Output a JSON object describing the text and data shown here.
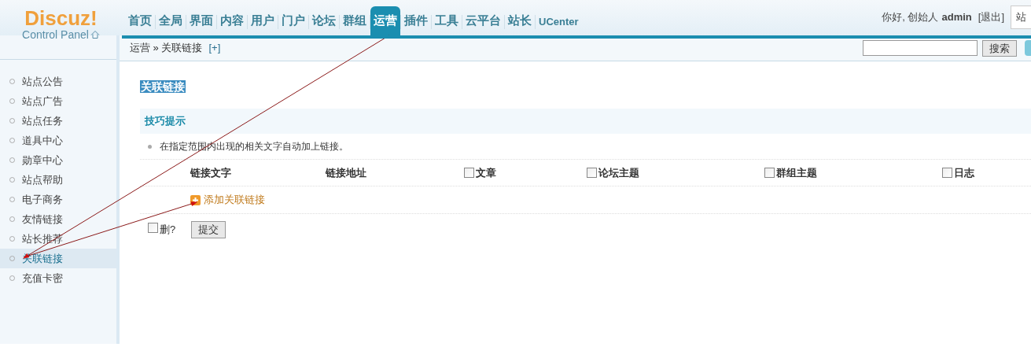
{
  "logo": {
    "title": "Discuz!",
    "subtitle": "Control Panel"
  },
  "nav_tabs": [
    {
      "label": "首页",
      "selected": false
    },
    {
      "label": "全局",
      "selected": false
    },
    {
      "label": "界面",
      "selected": false
    },
    {
      "label": "内容",
      "selected": false
    },
    {
      "label": "用户",
      "selected": false
    },
    {
      "label": "门户",
      "selected": false
    },
    {
      "label": "论坛",
      "selected": false
    },
    {
      "label": "群组",
      "selected": false
    },
    {
      "label": "运营",
      "selected": true
    },
    {
      "label": "插件",
      "selected": false
    },
    {
      "label": "工具",
      "selected": false
    },
    {
      "label": "云平台",
      "selected": false
    },
    {
      "label": "站长",
      "selected": false
    },
    {
      "label": "UCenter",
      "selected": false
    }
  ],
  "user_bar": {
    "greeting": "你好, 创始人",
    "username": "admin",
    "logout": "[退出]",
    "site_field": "站"
  },
  "breadcrumb": {
    "path": "运营 » 关联链接",
    "add": "[+]"
  },
  "search": {
    "button": "搜索"
  },
  "sidebar": {
    "items": [
      {
        "label": "站点公告",
        "selected": false
      },
      {
        "label": "站点广告",
        "selected": false
      },
      {
        "label": "站点任务",
        "selected": false
      },
      {
        "label": "道具中心",
        "selected": false
      },
      {
        "label": "勋章中心",
        "selected": false
      },
      {
        "label": "站点帮助",
        "selected": false
      },
      {
        "label": "电子商务",
        "selected": false
      },
      {
        "label": "友情链接",
        "selected": false
      },
      {
        "label": "站长推荐",
        "selected": false
      },
      {
        "label": "关联链接",
        "selected": true
      },
      {
        "label": "充值卡密",
        "selected": false
      }
    ]
  },
  "page_title": "关联链接",
  "tips": {
    "title": "技巧提示",
    "items": [
      "在指定范围内出现的相关文字自动加上链接。"
    ]
  },
  "table": {
    "columns": [
      {
        "label": "链接文字",
        "kind": "text"
      },
      {
        "label": "链接地址",
        "kind": "text"
      },
      {
        "label": "文章",
        "kind": "checkbox",
        "checked": false
      },
      {
        "label": "论坛主题",
        "kind": "checkbox",
        "checked": false
      },
      {
        "label": "群组主题",
        "kind": "checkbox",
        "checked": false
      },
      {
        "label": "日志",
        "kind": "checkbox",
        "checked": false
      }
    ],
    "add_link": "添加关联链接"
  },
  "footer": {
    "delete_label": "删?",
    "delete_checked": false,
    "submit": "提交"
  }
}
